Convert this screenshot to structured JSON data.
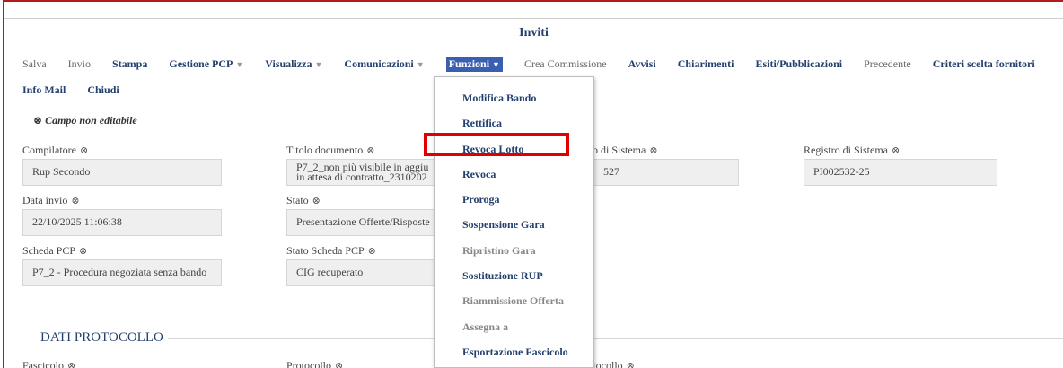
{
  "window": {
    "title": "Inviti"
  },
  "toolbar": {
    "row1": [
      {
        "label": "Salva",
        "style": "light",
        "caret": false
      },
      {
        "label": "Invio",
        "style": "light",
        "caret": false
      },
      {
        "label": "Stampa",
        "style": "bold",
        "caret": false
      },
      {
        "label": "Gestione PCP",
        "style": "bold",
        "caret": true
      },
      {
        "label": "Visualizza",
        "style": "bold",
        "caret": true
      },
      {
        "label": "Comunicazioni",
        "style": "bold",
        "caret": true
      },
      {
        "label": "Funzioni",
        "style": "active",
        "caret": true
      },
      {
        "label": "Crea Commissione",
        "style": "light",
        "caret": false
      },
      {
        "label": "Avvisi",
        "style": "bold",
        "caret": false
      },
      {
        "label": "Chiarimenti",
        "style": "bold",
        "caret": false
      },
      {
        "label": "Esiti/Pubblicazioni",
        "style": "bold",
        "caret": false
      },
      {
        "label": "Precedente",
        "style": "light",
        "caret": false
      },
      {
        "label": "Criteri scelta fornitori",
        "style": "bold",
        "caret": false
      }
    ],
    "row2": [
      {
        "label": "Info Mail",
        "style": "bold",
        "caret": false
      },
      {
        "label": "Chiudi",
        "style": "bold",
        "caret": false
      }
    ],
    "caret_glyph": "▼"
  },
  "non_editable_note": "Campo non editabile",
  "lock_glyph": "⊗",
  "fields": {
    "compilatore": {
      "label": "Compilatore",
      "value": "Rup Secondo"
    },
    "titolo": {
      "label": "Titolo documento",
      "value_line1": "P7_2_non più visibile in aggiu",
      "value_line2": "in attesa di contratto_2310202"
    },
    "registro_partial": {
      "label": "o di Sistema",
      "value": "527"
    },
    "registro": {
      "label": "Registro di Sistema",
      "value": "PI002532-25"
    },
    "data_invio": {
      "label": "Data invio",
      "value": "22/10/2025 11:06:38"
    },
    "stato": {
      "label": "Stato",
      "value": "Presentazione Offerte/Risposte"
    },
    "scheda_pcp": {
      "label": "Scheda PCP",
      "value": "P7_2 - Procedura negoziata senza bando"
    },
    "stato_scheda": {
      "label": "Stato Scheda PCP",
      "value": "CIG recuperato"
    }
  },
  "section": {
    "title": "DATI PROTOCOLLO",
    "fascicolo": "Fascicolo",
    "protocollo": "Protocollo",
    "data_protocollo": "Data Protocollo"
  },
  "dropdown": {
    "items": [
      {
        "label": "Modifica Bando",
        "enabled": true
      },
      {
        "label": "Rettifica",
        "enabled": true
      },
      {
        "label": "Revoca Lotto",
        "enabled": true
      },
      {
        "label": "Revoca",
        "enabled": true
      },
      {
        "label": "Proroga",
        "enabled": true
      },
      {
        "label": "Sospensione Gara",
        "enabled": true
      },
      {
        "label": "Ripristino Gara",
        "enabled": false
      },
      {
        "label": "Sostituzione RUP",
        "enabled": true
      },
      {
        "label": "Riammissione Offerta",
        "enabled": false
      },
      {
        "label": "Assegna a",
        "enabled": false
      },
      {
        "label": "Esportazione Fascicolo",
        "enabled": true
      }
    ],
    "highlighted_item": "Revoca Lotto"
  },
  "colors": {
    "accent": "#23406e",
    "active_tab": "#3b5fb0",
    "highlight": "#e00000",
    "frame": "#b31b1b"
  }
}
